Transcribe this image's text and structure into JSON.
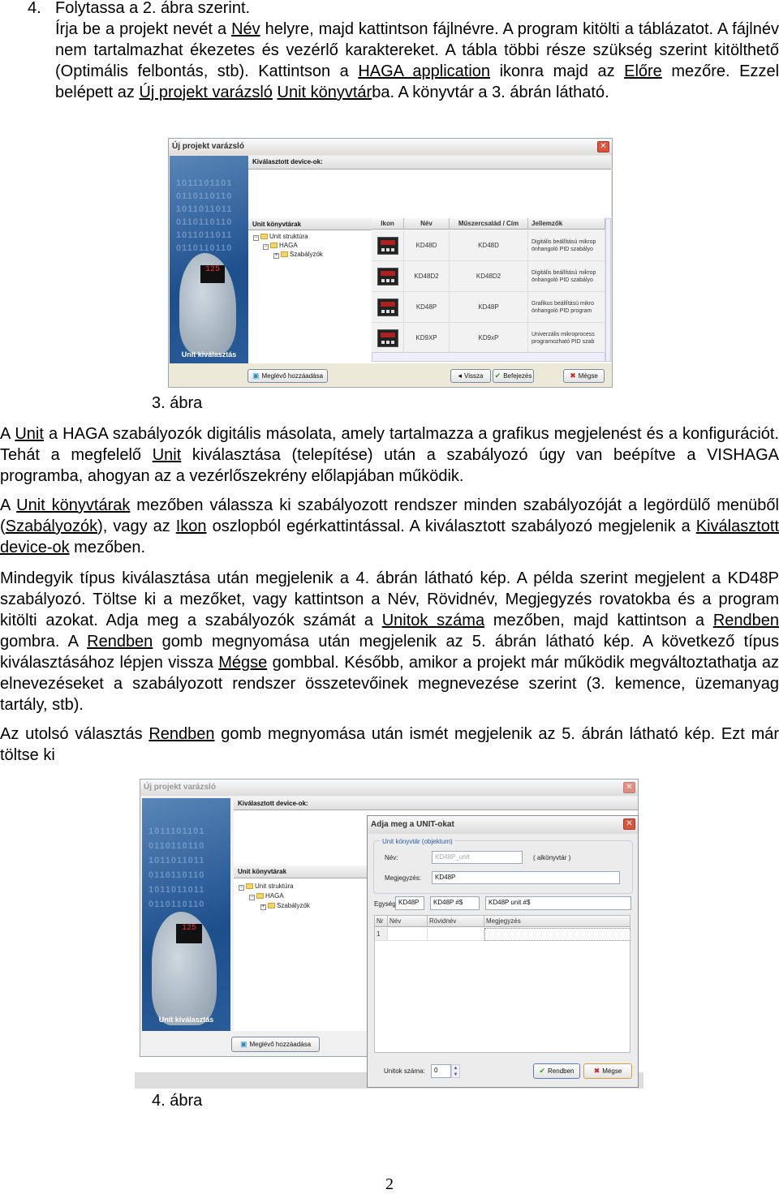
{
  "step": {
    "number": "4.",
    "title": "Folytassa a 2. ábra szerint."
  },
  "intro": [
    {
      "t": "Írja be a projekt nevét a "
    },
    {
      "t": "Név",
      "u": true
    },
    {
      "t": " helyre, majd kattintson fájlnévre. A program kitölti a táblázatot. A fájlnév nem tartalmazhat ékezetes és vezérlő karaktereket. A tábla többi része szükség szerint kitölthető (Optimális felbontás, stb). Kattintson a "
    },
    {
      "t": "HAGA application",
      "u": true
    },
    {
      "t": " ikonra majd az "
    },
    {
      "t": "Előre",
      "u": true
    },
    {
      "t": " mezőre. Ezzel belépett az "
    },
    {
      "t": "Új projekt varázsló",
      "u": true
    },
    {
      "t": " "
    },
    {
      "t": "Unit könyvtár",
      "u": true
    },
    {
      "t": "ba. A könyvtár a 3. ábrán látható."
    }
  ],
  "figure3": {
    "caption": "3. ábra",
    "window_title": "Új projekt varázsló",
    "close": "✕",
    "binary": [
      "1011101101",
      "0110110110",
      "1011011011",
      "0110110110",
      "1011011011",
      "0110110110"
    ],
    "display": "125",
    "side_label": "Unit kiválasztás",
    "selected_header": "Kiválasztott device-ok:",
    "library_header": "Unit könyvtárak",
    "tree": [
      "Unit struktúra",
      "HAGA",
      "Szabályzók"
    ],
    "columns": [
      "Ikon",
      "Név",
      "Műszercsalád / Cím",
      "Jellemzők"
    ],
    "rows": [
      {
        "name": "KD48D",
        "family": "KD48D",
        "desc1": "Digitális beállítású mikrop",
        "desc2": "önhangoló PID szabályo"
      },
      {
        "name": "KD48D2",
        "family": "KD48D2",
        "desc1": "Digitális beállítású mikrop",
        "desc2": "önhangoló PID szabályo"
      },
      {
        "name": "KD48P",
        "family": "KD48P",
        "desc1": "Grafikus beállítású mikro",
        "desc2": "önhangoló PID program"
      },
      {
        "name": "KD9XP",
        "family": "KD9xP",
        "desc1": "Univerzális mikroprocess",
        "desc2": "programozható PID szab"
      }
    ],
    "buttons": {
      "add_existing": "Meglévő hozzáadása",
      "back": "Vissza",
      "finish": "Befejezés",
      "cancel": "Mégse"
    }
  },
  "paragraphs": [
    [
      {
        "t": "A "
      },
      {
        "t": "Unit",
        "u": true
      },
      {
        "t": " a HAGA szabályozók digitális másolata, amely tartalmazza a grafikus megjelenést és a konfigurációt. Tehát a megfelelő "
      },
      {
        "t": "Unit",
        "u": true
      },
      {
        "t": " kiválasztása (telepítése) után a szabályozó úgy van beépítve a VISHAGA programba, ahogyan az a vezérlőszekrény előlapjában működik."
      }
    ],
    [
      {
        "t": "A "
      },
      {
        "t": "Unit könyvtárak",
        "u": true
      },
      {
        "t": " mezőben válassza ki szabályozott rendszer minden szabályozóját a legördülő menüből ("
      },
      {
        "t": "Szabályozók",
        "u": true
      },
      {
        "t": "), vagy az "
      },
      {
        "t": "Ikon",
        "u": true
      },
      {
        "t": " oszlopból egérkattintással. A kiválasztott szabályozó megjelenik a "
      },
      {
        "t": "Kiválasztott device-ok",
        "u": true
      },
      {
        "t": " mezőben."
      }
    ],
    [
      {
        "t": "Mindegyik típus kiválasztása után megjelenik a 4. ábrán látható kép. A példa szerint megjelent a KD48P szabályozó. Töltse ki a mezőket, vagy kattintson a Név, Rövidnév, Megjegyzés rovatokba és a program kitölti azokat. Adja meg a szabályozók számát a "
      },
      {
        "t": "Unitok száma",
        "u": true
      },
      {
        "t": " mezőben, majd kattintson a "
      },
      {
        "t": "Rendben",
        "u": true
      },
      {
        "t": " gombra. A "
      },
      {
        "t": "Rendben",
        "u": true
      },
      {
        "t": " gomb megnyomása után megjelenik az 5. ábrán látható kép. A következő típus kiválasztásához lépjen vissza "
      },
      {
        "t": "Mégse",
        "u": true
      },
      {
        "t": " gombbal. Később, amikor a projekt már működik megváltoztathatja az elnevezéseket a szabályozott rendszer összetevőinek megnevezése szerint (3. kemence, üzemanyag tartály, stb)."
      }
    ],
    [
      {
        "t": "Az utolsó választás "
      },
      {
        "t": "Rendben",
        "u": true
      },
      {
        "t": " gomb megnyomása után ismét megjelenik az 5. ábrán látható kép. Ezt már töltse ki"
      }
    ]
  ],
  "figure4": {
    "caption": "4. ábra",
    "window_title": "Új projekt varázsló",
    "selected_header": "Kiválasztott device-ok:",
    "library_header": "Unit könyvtárak",
    "tree": [
      "Unit struktúra",
      "HAGA",
      "Szabályzók"
    ],
    "side_label": "Unit kiválasztás",
    "add_existing": "Meglévő hozzáadása",
    "dialog": {
      "title": "Adja meg a UNIT-okat",
      "group_label": "Unit könyvtár (objektum)",
      "name_label": "Név:",
      "name_value": "KD48P_unit",
      "sublibrary": "( alkönyvtár )",
      "note_label": "Megjegyzés:",
      "note_value": "KD48P",
      "unit_label": "Egység:",
      "unit_values": [
        "KD48P",
        "KD48P #$",
        "KD48P unit #$"
      ],
      "columns": [
        "Nr",
        "Név",
        "Rövidnév",
        "Megjegyzés"
      ],
      "rows": [
        [
          "1",
          "",
          "",
          ""
        ]
      ],
      "count_label": "Unitok száma:",
      "count_value": "0",
      "ok": "Rendben",
      "cancel": "Mégse"
    }
  },
  "page_number": "2",
  "colors": {
    "accent_blue": "#1d4f8c",
    "close_red": "#d9553c",
    "ok_green": "#2a9a2a",
    "cancel_red": "#cc2222"
  }
}
